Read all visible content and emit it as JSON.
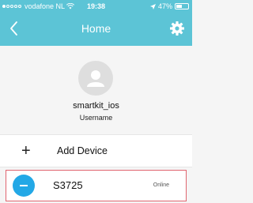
{
  "status_bar": {
    "carrier": "vodafone NL",
    "time": "19:38",
    "battery": "47%"
  },
  "navbar": {
    "title": "Home"
  },
  "profile": {
    "username": "smartkit_ios",
    "username_label": "Username"
  },
  "add_device": {
    "label": "Add Device"
  },
  "device": {
    "name": "S3725",
    "status": "Online"
  },
  "colors": {
    "accent": "#5cc4d6",
    "device_icon": "#23a8e6",
    "highlight": "#e06570"
  },
  "icons": {
    "back": "chevron-left-icon",
    "settings": "gear-icon",
    "avatar": "user-icon",
    "add": "plus-icon",
    "device": "device-icon"
  }
}
